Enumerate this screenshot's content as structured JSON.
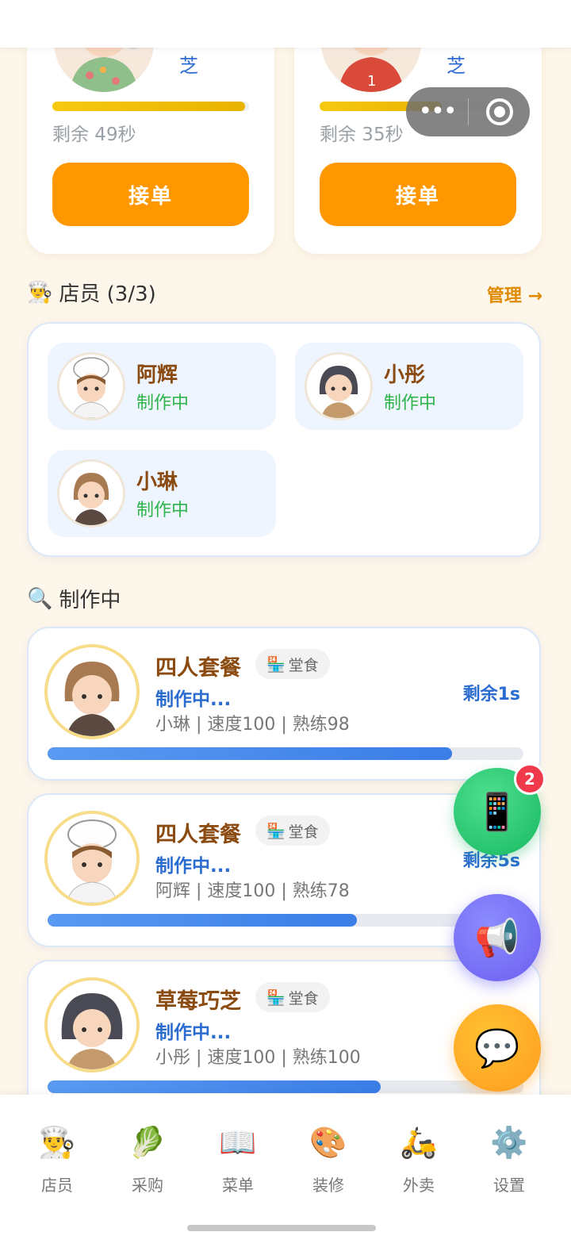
{
  "orders": [
    {
      "customer_name": "芝",
      "remain": "剩余 49秒",
      "accept_label": "接单",
      "timer_fraction": 0.98
    },
    {
      "customer_name": "芝",
      "remain": "剩余 35秒",
      "accept_label": "接单",
      "timer_fraction": 0.62
    }
  ],
  "staff_section": {
    "title": "店员 (3/3)",
    "icon": "chef-icon",
    "manage_label": "管理 →"
  },
  "staff": [
    {
      "name": "阿辉",
      "status": "制作中"
    },
    {
      "name": "小彤",
      "status": "制作中"
    },
    {
      "name": "小琳",
      "status": "制作中"
    }
  ],
  "making_section": {
    "title": "制作中",
    "icon": "magnifier-icon"
  },
  "making": [
    {
      "dish": "四人套餐",
      "tag": "堂食",
      "status": "制作中...",
      "meta": "小琳 | 速度100 | 熟练98",
      "remain": "剩余1s",
      "progress": 0.85
    },
    {
      "dish": "四人套餐",
      "tag": "堂食",
      "status": "制作中...",
      "meta": "阿辉 | 速度100 | 熟练78",
      "remain": "剩余5s",
      "progress": 0.65
    },
    {
      "dish": "草莓巧芝",
      "tag": "堂食",
      "status": "制作中...",
      "meta": "小彤 | 速度100 | 熟练100",
      "remain": "",
      "progress": 0.7
    }
  ],
  "fabs": {
    "phone_badge": "2"
  },
  "tabs": [
    {
      "label": "店员",
      "icon": "chef-icon"
    },
    {
      "label": "采购",
      "icon": "lettuce-icon"
    },
    {
      "label": "菜单",
      "icon": "book-icon"
    },
    {
      "label": "装修",
      "icon": "palette-icon"
    },
    {
      "label": "外卖",
      "icon": "scooter-icon"
    },
    {
      "label": "设置",
      "icon": "gear-icon"
    }
  ],
  "colors": {
    "accent": "#ff9800",
    "link": "#2a6ccf",
    "making_status": "#2db44a",
    "background": "#fdf6ea"
  }
}
